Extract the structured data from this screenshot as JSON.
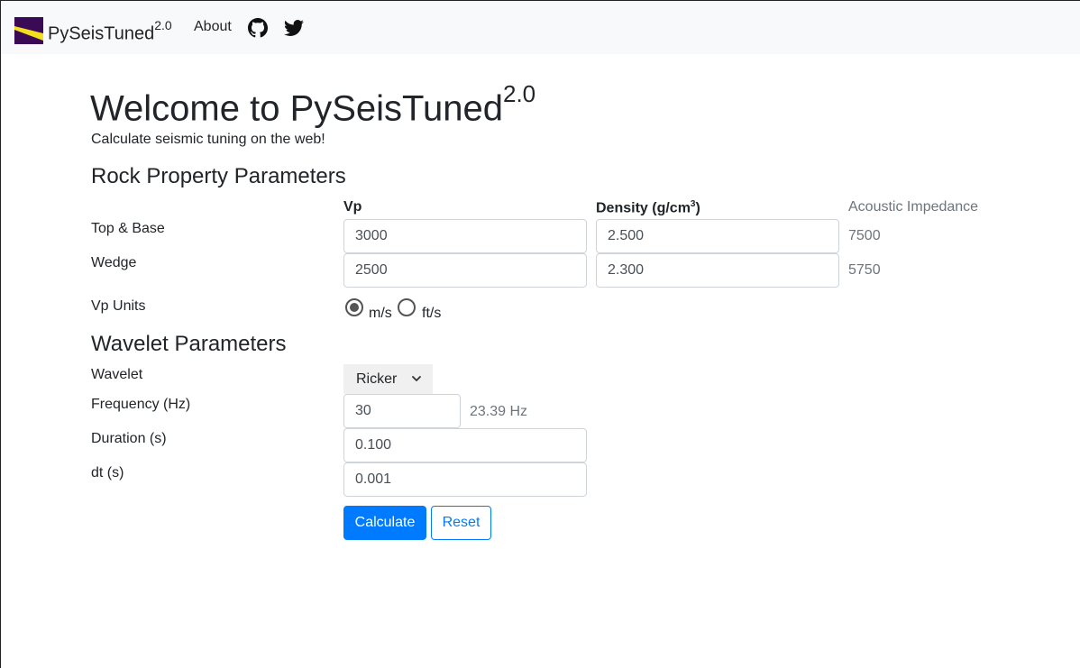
{
  "brand": {
    "name": "PySeisTuned",
    "version": "2.0"
  },
  "nav": {
    "about": "About"
  },
  "colors": {
    "primary": "#007bff",
    "muted": "#6c757d",
    "navbar_bg": "#f8f9fa",
    "logo_purple": "#3b0a57",
    "logo_yellow": "#f2e01e"
  },
  "icons": {
    "github": "github-icon",
    "twitter": "twitter-icon",
    "select_chevron": "chevron-down-icon"
  },
  "page": {
    "title": "Welcome to PySeisTuned",
    "title_version": "2.0",
    "subtitle": "Calculate seismic tuning on the web!"
  },
  "rock": {
    "heading": "Rock Property Parameters",
    "col_vp": "Vp",
    "col_density": "Density (g/cm",
    "col_density_sup": "3",
    "col_density_close": ")",
    "col_ai": "Acoustic Impedance",
    "rows": [
      {
        "label": "Top & Base",
        "vp": "3000",
        "density": "2.500",
        "ai": "7500"
      },
      {
        "label": "Wedge",
        "vp": "2500",
        "density": "2.300",
        "ai": "5750"
      }
    ],
    "units_label": "Vp Units",
    "units": [
      {
        "label": "m/s",
        "checked": true
      },
      {
        "label": "ft/s",
        "checked": false
      }
    ]
  },
  "wavelet": {
    "heading": "Wavelet Parameters",
    "wavelet_label": "Wavelet",
    "wavelet_selected": "Ricker",
    "freq_label": "Frequency (Hz)",
    "freq_value": "30",
    "freq_note": "23.39 Hz",
    "duration_label": "Duration (s)",
    "duration_value": "0.100",
    "dt_label": "dt (s)",
    "dt_value": "0.001"
  },
  "buttons": {
    "calculate": "Calculate",
    "reset": "Reset"
  }
}
